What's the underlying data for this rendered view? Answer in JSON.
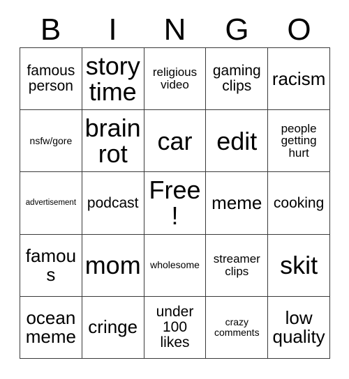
{
  "card": {
    "header_letters": [
      "B",
      "I",
      "N",
      "G",
      "O"
    ],
    "rows": [
      [
        {
          "text": "famous person",
          "size": "fs-m"
        },
        {
          "text": "story time",
          "size": "fs-xxl"
        },
        {
          "text": "religious video",
          "size": "fs-s"
        },
        {
          "text": "gaming clips",
          "size": "fs-m"
        },
        {
          "text": "racism",
          "size": "fs-l"
        }
      ],
      [
        {
          "text": "nsfw/gore",
          "size": "fs-xs"
        },
        {
          "text": "brain rot",
          "size": "fs-xxl"
        },
        {
          "text": "car",
          "size": "fs-xxl"
        },
        {
          "text": "edit",
          "size": "fs-xxl"
        },
        {
          "text": "people getting hurt",
          "size": "fs-s"
        }
      ],
      [
        {
          "text": "advertisement",
          "size": "fs-xxs"
        },
        {
          "text": "podcast",
          "size": "fs-m"
        },
        {
          "text": "Free!",
          "size": "fs-xxl"
        },
        {
          "text": "meme",
          "size": "fs-l"
        },
        {
          "text": "cooking",
          "size": "fs-m"
        }
      ],
      [
        {
          "text": "famous",
          "size": "fs-l"
        },
        {
          "text": "mom",
          "size": "fs-xxl"
        },
        {
          "text": "wholesome",
          "size": "fs-xs"
        },
        {
          "text": "streamer clips",
          "size": "fs-s"
        },
        {
          "text": "skit",
          "size": "fs-xxl"
        }
      ],
      [
        {
          "text": "ocean meme",
          "size": "fs-l"
        },
        {
          "text": "cringe",
          "size": "fs-l"
        },
        {
          "text": "under 100 likes",
          "size": "fs-m"
        },
        {
          "text": "crazy comments",
          "size": "fs-xs"
        },
        {
          "text": "low quality",
          "size": "fs-l"
        }
      ]
    ]
  }
}
